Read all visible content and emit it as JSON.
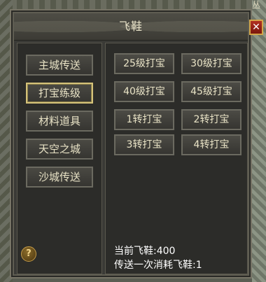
{
  "window": {
    "title": "飞鞋",
    "close_label": "✕",
    "corner_glyph": "丛"
  },
  "sidebar": {
    "items": [
      {
        "label": "主城传送",
        "active": false
      },
      {
        "label": "打宝练级",
        "active": true
      },
      {
        "label": "材料道具",
        "active": false
      },
      {
        "label": "天空之城",
        "active": false
      },
      {
        "label": "沙城传送",
        "active": false
      }
    ]
  },
  "destinations": [
    "25级打宝",
    "30级打宝",
    "40级打宝",
    "45级打宝",
    "1转打宝",
    "2转打宝",
    "3转打宝",
    "4转打宝"
  ],
  "info": {
    "current_shoes": "当前飞鞋:400",
    "cost": "传送一次消耗飞鞋:1"
  },
  "help_label": "?"
}
